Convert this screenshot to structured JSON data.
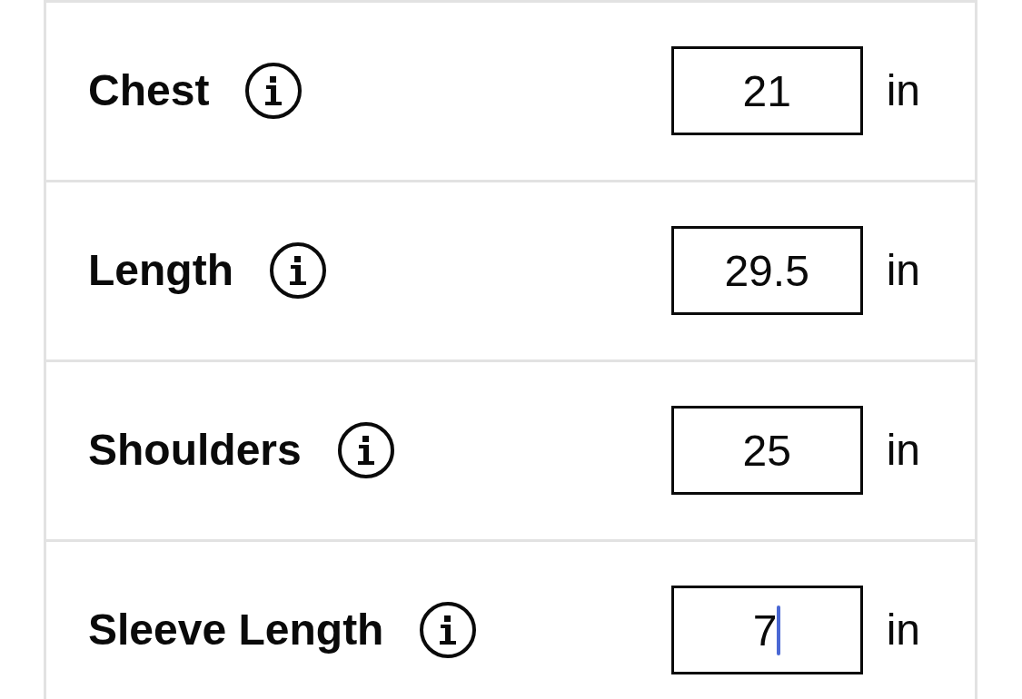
{
  "rows": [
    {
      "label": "Chest",
      "value": "21",
      "unit": "in",
      "focused": false
    },
    {
      "label": "Length",
      "value": "29.5",
      "unit": "in",
      "focused": false
    },
    {
      "label": "Shoulders",
      "value": "25",
      "unit": "in",
      "focused": false
    },
    {
      "label": "Sleeve Length",
      "value": "7",
      "unit": "in",
      "focused": true
    }
  ]
}
